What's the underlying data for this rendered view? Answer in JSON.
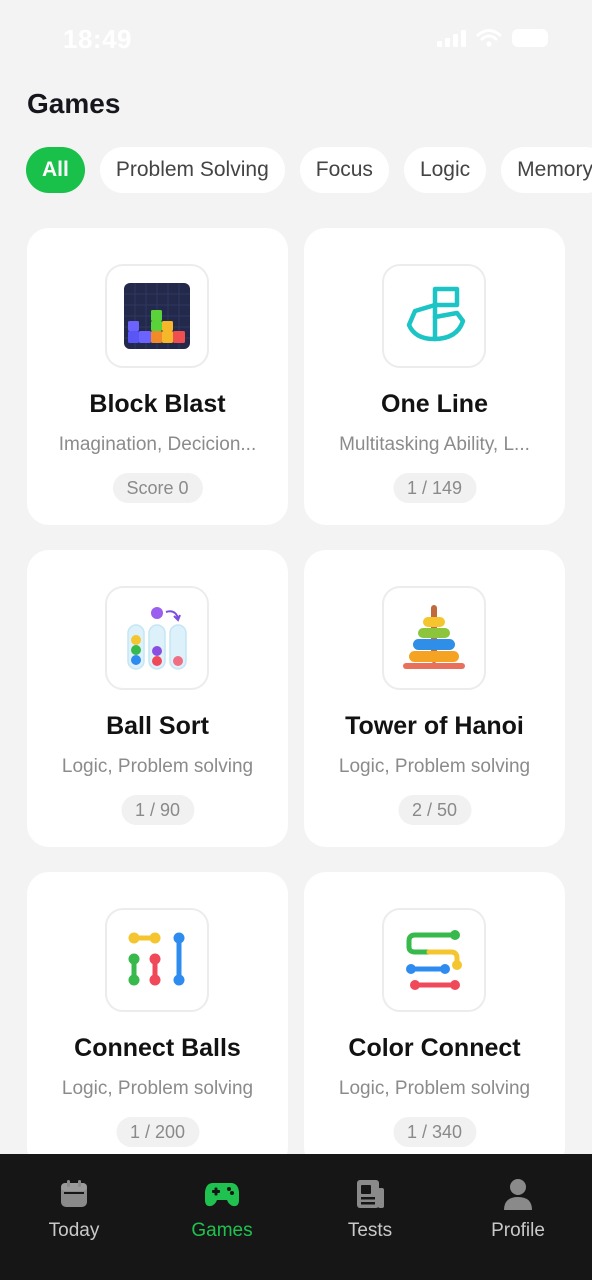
{
  "status_bar": {
    "time": "18:49"
  },
  "header": {
    "title": "Games"
  },
  "filters": [
    "All",
    "Problem Solving",
    "Focus",
    "Logic",
    "Memory"
  ],
  "games": [
    {
      "title": "Block Blast",
      "tags": "Imagination, Decicion...",
      "badge": "Score 0",
      "icon": "block-blast-icon"
    },
    {
      "title": "One Line",
      "tags": "Multitasking Ability, L...",
      "badge": "1 / 149",
      "icon": "one-line-icon"
    },
    {
      "title": "Ball Sort",
      "tags": "Logic, Problem solving",
      "badge": "1 / 90",
      "icon": "ball-sort-icon"
    },
    {
      "title": "Tower of Hanoi",
      "tags": "Logic, Problem solving",
      "badge": "2 / 50",
      "icon": "tower-of-hanoi-icon"
    },
    {
      "title": "Connect Balls",
      "tags": "Logic, Problem solving",
      "badge": "1 / 200",
      "icon": "connect-balls-icon"
    },
    {
      "title": "Color Connect",
      "tags": "Logic, Problem solving",
      "badge": "1 / 340",
      "icon": "color-connect-icon"
    }
  ],
  "nav": [
    {
      "label": "Today",
      "icon": "calendar-icon"
    },
    {
      "label": "Games",
      "icon": "gamepad-icon",
      "active": true
    },
    {
      "label": "Tests",
      "icon": "document-icon"
    },
    {
      "label": "Profile",
      "icon": "person-icon"
    }
  ],
  "colors": {
    "accent": "#19c04a",
    "nav_background": "#161616",
    "nav_inactive": "#c9c9c9"
  }
}
